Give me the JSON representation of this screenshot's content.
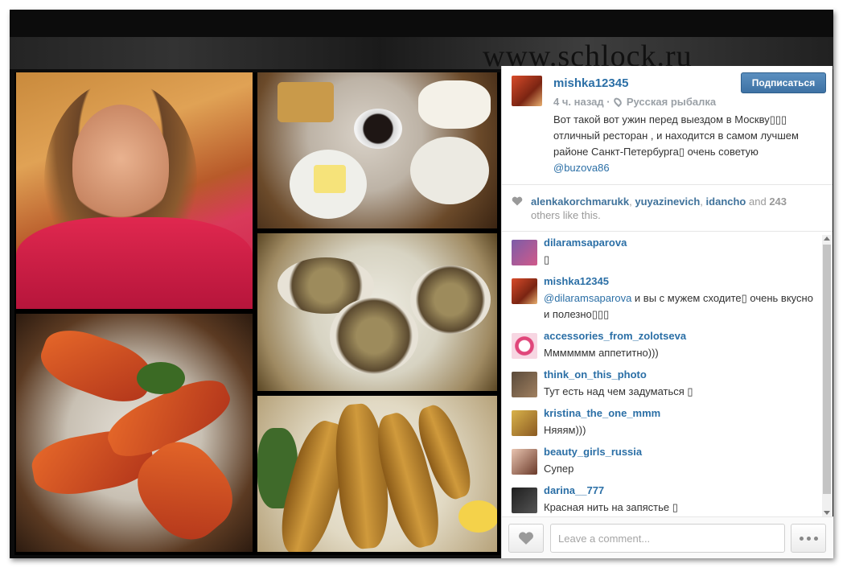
{
  "watermark": "www.schlock.ru",
  "post": {
    "username": "mishka12345",
    "follow_label": "Подписаться",
    "time_ago": "4 ч. назад",
    "separator": "·",
    "location": "Русская рыбалка",
    "caption": "Вот такой вот ужин перед выездом в Москву▯▯▯ отличный ресторан , и находится в самом лучшем районе Санкт-Петербурга▯ очень советую",
    "caption_mention": "@buzova86"
  },
  "likes": {
    "users": [
      "alenkakorchmarukk",
      "yuyazinevich",
      "idancho"
    ],
    "and_text": "and",
    "count": "243",
    "suffix": "others like this."
  },
  "comments": [
    {
      "user": "dilaramsaparova",
      "text": "▯",
      "avatar_color": "#7c5ca8"
    },
    {
      "user": "mishka12345",
      "mention": "@dilaramsaparova",
      "text": " и вы с мужем сходите▯ очень вкусно и полезно▯▯▯",
      "avatar_color": "#b04a24"
    },
    {
      "user": "accessories_from_zolotseva",
      "text": "Ммммммм аппетитно)))",
      "avatar_color": "#e0467a"
    },
    {
      "user": "think_on_this_photo",
      "text": "Тут есть над чем задуматься ▯",
      "avatar_color": "#5a4a3a"
    },
    {
      "user": "kristina_the_one_mmm",
      "text": "Няяям)))",
      "avatar_color": "#d9b24a"
    },
    {
      "user": "beauty_girls_russia",
      "text": "Супер",
      "avatar_color": "#6a3a2a"
    },
    {
      "user": "darina__777",
      "text": "Красная нить на запястье ▯",
      "avatar_color": "#1e1e1e"
    }
  ],
  "footer": {
    "comment_placeholder": "Leave a comment..."
  },
  "colors": {
    "link": "#2b6fa6",
    "follow_button": "#3e72a4"
  },
  "icons": [
    "heart-icon",
    "location-pin-icon",
    "more-dots-icon"
  ]
}
